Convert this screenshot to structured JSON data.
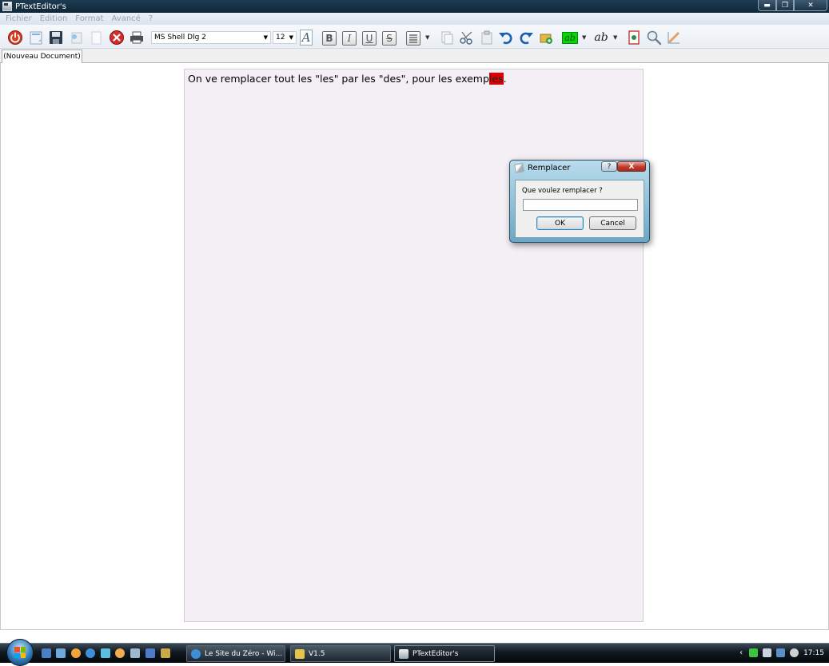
{
  "window": {
    "title": "PTextEditor's"
  },
  "menu": {
    "items": [
      "Fichier",
      "Edition",
      "Format",
      "Avancé",
      "?"
    ]
  },
  "toolbar": {
    "font_name": "MS Shell Dlg 2",
    "font_size": "12",
    "bold_label": "B",
    "italic_label": "I",
    "underline_label": "U",
    "strike_label": "S",
    "font_color_label": "A",
    "highlight_label": "ab",
    "text_style_label": "ab"
  },
  "tabs": [
    {
      "label": "(Nouveau Document)"
    }
  ],
  "document": {
    "text_before": "On ve remplacer tout les \"les\" par les \"des\", pour les exemp",
    "text_selected": "les",
    "text_after": "."
  },
  "dialog": {
    "title": "Remplacer",
    "help_label": "?",
    "close_label": "X",
    "prompt": "Que voulez remplacer ?",
    "input_value": "",
    "ok_label": "OK",
    "cancel_label": "Cancel"
  },
  "taskbar": {
    "tasks": [
      {
        "label": "Le Site du Zéro - Wi..."
      },
      {
        "label": "V1.5"
      },
      {
        "label": "PTextEditor's"
      }
    ],
    "clock": "17:15"
  },
  "colors": {
    "selection": "#e00000",
    "page_background": "#f4eff4",
    "highlight_green": "#00d800"
  }
}
